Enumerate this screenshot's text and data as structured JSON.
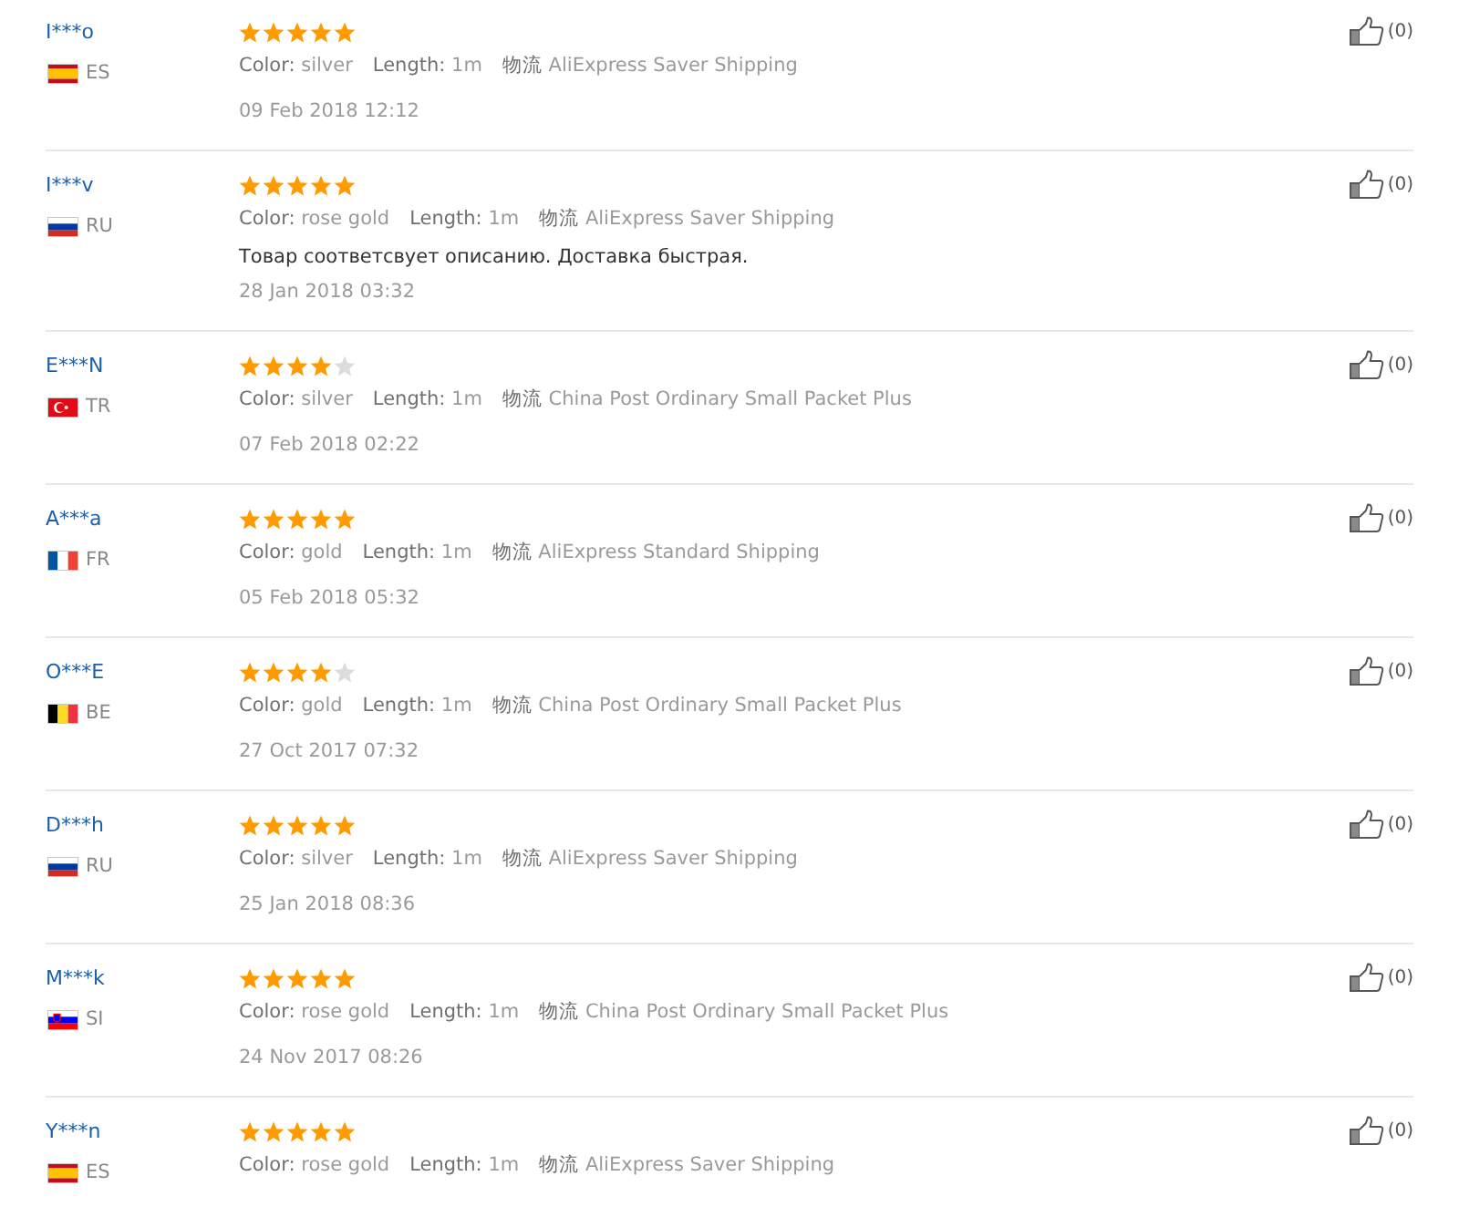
{
  "reviews": [
    {
      "name": "I***o",
      "country": "ES",
      "flag": {
        "kind": "spain"
      },
      "stars": 5,
      "attributes": [
        {
          "label": "Color:",
          "value": "silver"
        },
        {
          "label": "Length:",
          "value": "1m"
        },
        {
          "label": "物流",
          "value": "AliExpress Saver Shipping"
        }
      ],
      "date": "09 Feb 2018 12:12",
      "helpful": "(0)"
    },
    {
      "name": "I***v",
      "country": "RU",
      "flag": {
        "kind": "russia"
      },
      "stars": 5,
      "attributes": [
        {
          "label": "Color:",
          "value": "rose gold"
        },
        {
          "label": "Length:",
          "value": "1m"
        },
        {
          "label": "物流",
          "value": "AliExpress Saver Shipping"
        }
      ],
      "comment": "Товар соответсвует описанию. Доставка быстрая.",
      "date": "28 Jan 2018 03:32",
      "helpful": "(0)"
    },
    {
      "name": "E***N",
      "country": "TR",
      "flag": {
        "kind": "turkey"
      },
      "stars": 4,
      "attributes": [
        {
          "label": "Color:",
          "value": "silver"
        },
        {
          "label": "Length:",
          "value": "1m"
        },
        {
          "label": "物流",
          "value": "China Post Ordinary Small Packet Plus"
        }
      ],
      "date": "07 Feb 2018 02:22",
      "helpful": "(0)"
    },
    {
      "name": "A***a",
      "country": "FR",
      "flag": {
        "kind": "france"
      },
      "stars": 5,
      "attributes": [
        {
          "label": "Color:",
          "value": "gold"
        },
        {
          "label": "Length:",
          "value": "1m"
        },
        {
          "label": "物流",
          "value": "AliExpress Standard Shipping"
        }
      ],
      "date": "05 Feb 2018 05:32",
      "helpful": "(0)"
    },
    {
      "name": "O***E",
      "country": "BE",
      "flag": {
        "kind": "belgium"
      },
      "stars": 4,
      "attributes": [
        {
          "label": "Color:",
          "value": "gold"
        },
        {
          "label": "Length:",
          "value": "1m"
        },
        {
          "label": "物流",
          "value": "China Post Ordinary Small Packet Plus"
        }
      ],
      "date": "27 Oct 2017 07:32",
      "helpful": "(0)"
    },
    {
      "name": "D***h",
      "country": "RU",
      "flag": {
        "kind": "russia"
      },
      "stars": 5,
      "attributes": [
        {
          "label": "Color:",
          "value": "silver"
        },
        {
          "label": "Length:",
          "value": "1m"
        },
        {
          "label": "物流",
          "value": "AliExpress Saver Shipping"
        }
      ],
      "date": "25 Jan 2018 08:36",
      "helpful": "(0)"
    },
    {
      "name": "M***k",
      "country": "SI",
      "flag": {
        "kind": "slovenia"
      },
      "stars": 5,
      "attributes": [
        {
          "label": "Color:",
          "value": "rose gold"
        },
        {
          "label": "Length:",
          "value": "1m"
        },
        {
          "label": "物流",
          "value": "China Post Ordinary Small Packet Plus"
        }
      ],
      "date": "24 Nov 2017 08:26",
      "helpful": "(0)"
    },
    {
      "name": "Y***n",
      "country": "ES",
      "flag": {
        "kind": "spain"
      },
      "stars": 5,
      "attributes": [
        {
          "label": "Color:",
          "value": "rose gold"
        },
        {
          "label": "Length:",
          "value": "1m"
        },
        {
          "label": "物流",
          "value": "AliExpress Saver Shipping"
        }
      ],
      "helpful": "(0)"
    }
  ]
}
